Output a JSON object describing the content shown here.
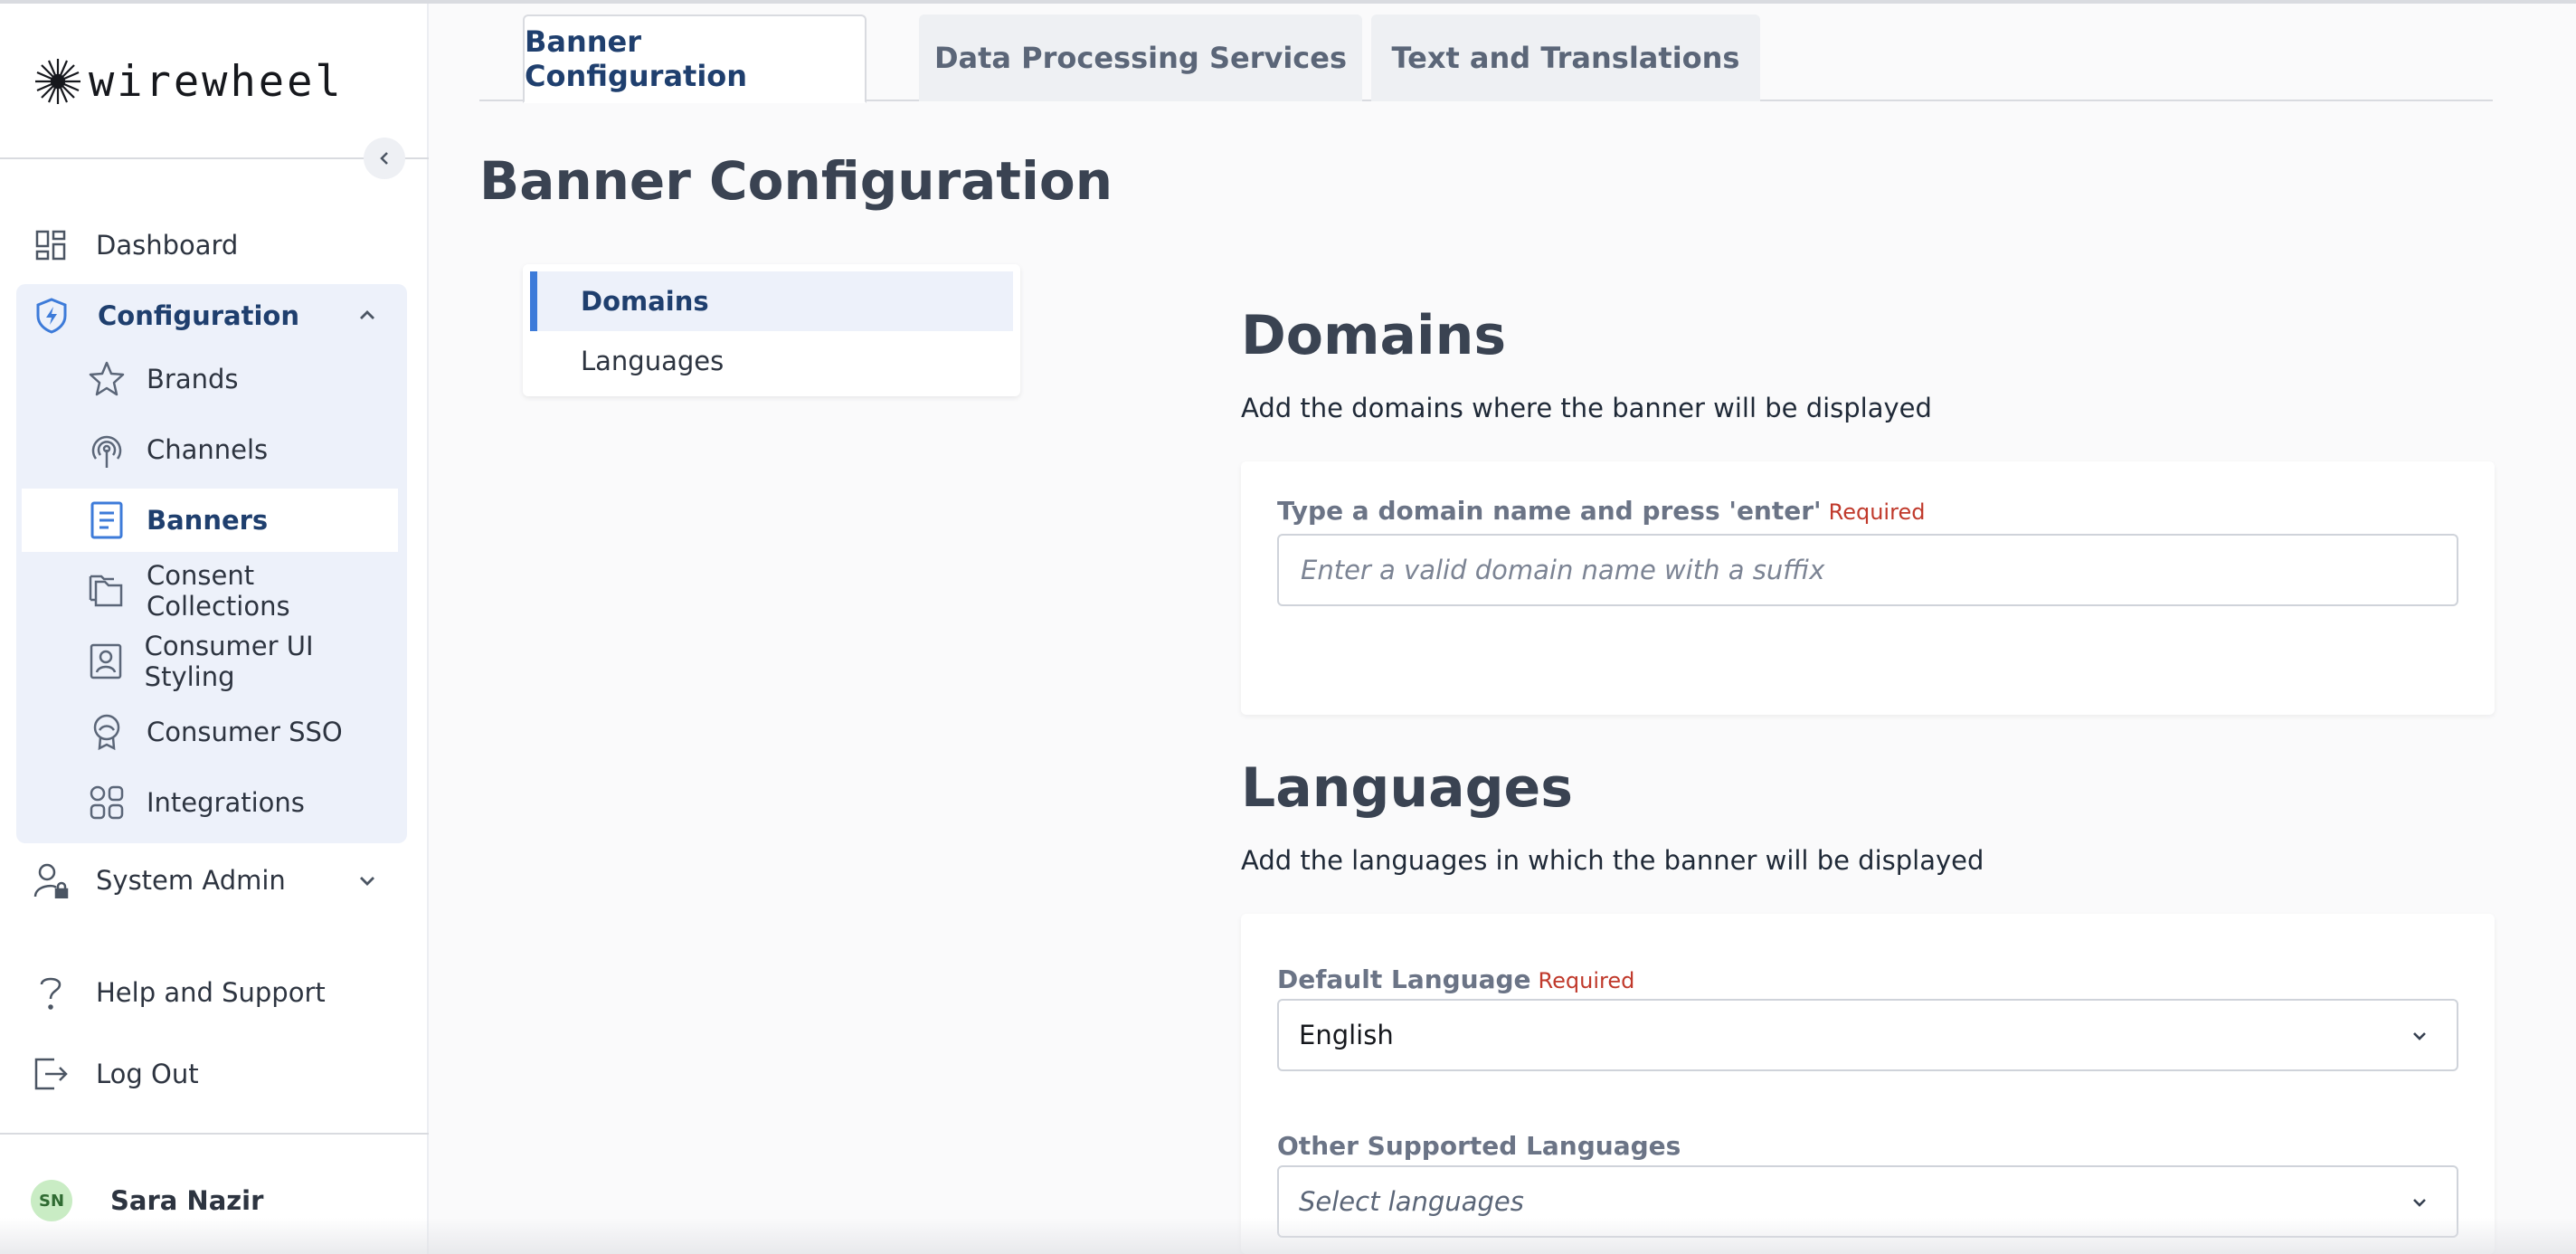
{
  "app": {
    "logo_text": "wirewheel"
  },
  "sidebar": {
    "items": [
      {
        "label": "Dashboard",
        "icon": "dashboard-icon"
      },
      {
        "label": "Configuration",
        "icon": "shield-bolt-icon"
      },
      {
        "label": "System Admin",
        "icon": "user-lock-icon"
      },
      {
        "label": "Help and Support",
        "icon": "question-icon"
      },
      {
        "label": "Log Out",
        "icon": "logout-icon"
      }
    ],
    "config_items": [
      {
        "label": "Brands",
        "icon": "star-icon"
      },
      {
        "label": "Channels",
        "icon": "broadcast-icon"
      },
      {
        "label": "Banners",
        "icon": "document-icon"
      },
      {
        "label": "Consent Collections",
        "icon": "folders-icon"
      },
      {
        "label": "Consumer UI Styling",
        "icon": "portrait-icon"
      },
      {
        "label": "Consumer SSO",
        "icon": "badge-icon"
      },
      {
        "label": "Integrations",
        "icon": "grid-icon"
      }
    ],
    "active_item": "Banners",
    "user": {
      "initials": "SN",
      "name": "Sara Nazir"
    }
  },
  "tabs": [
    {
      "label": "Banner Configuration",
      "active": true
    },
    {
      "label": "Data Processing Services",
      "active": false
    },
    {
      "label": "Text and Translations",
      "active": false
    }
  ],
  "page": {
    "title": "Banner Configuration",
    "subnav": [
      {
        "label": "Domains",
        "active": true
      },
      {
        "label": "Languages",
        "active": false
      }
    ]
  },
  "domains": {
    "title": "Domains",
    "description": "Add the domains where the banner will be displayed",
    "field_label": "Type a domain name and press 'enter'",
    "required": "Required",
    "placeholder": "Enter a valid domain name with a suffix"
  },
  "languages": {
    "title": "Languages",
    "description": "Add the languages in which the banner will be displayed",
    "default_label": "Default Language",
    "required": "Required",
    "default_value": "English",
    "other_label": "Other Supported Languages",
    "other_placeholder": "Select languages"
  },
  "colors": {
    "accent": "#3d7bd9",
    "active_text": "#1f3f6e",
    "active_bg": "#edf1fa",
    "required": "#c0392b"
  }
}
